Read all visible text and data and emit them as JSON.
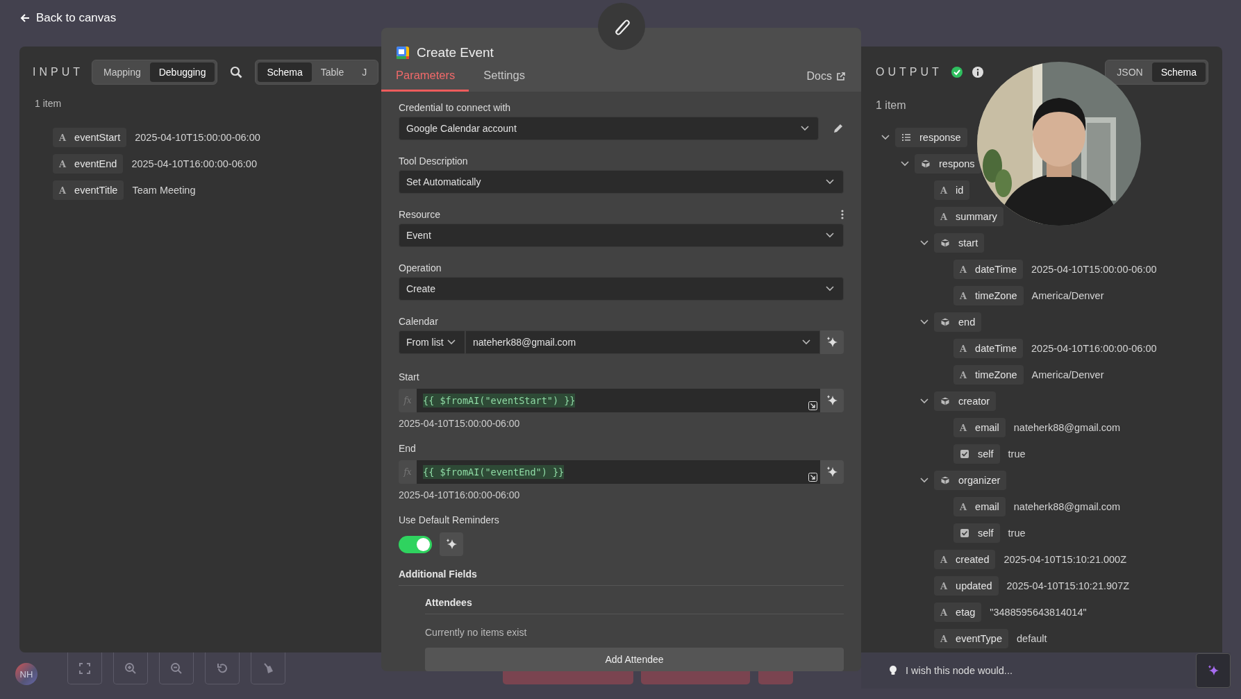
{
  "top_bar": {
    "back_link": "Back to canvas"
  },
  "input_panel": {
    "title": "INPUT",
    "mode_tabs": [
      {
        "label": "Mapping",
        "selected": false
      },
      {
        "label": "Debugging",
        "selected": true
      }
    ],
    "view_tabs": [
      {
        "label": "Schema",
        "selected": true
      },
      {
        "label": "Table",
        "selected": false
      },
      {
        "label": "J",
        "selected": false
      }
    ],
    "item_count": "1 item",
    "fields": [
      {
        "kind": "string",
        "type_glyph": "A",
        "key": "eventStart",
        "value": "2025-04-10T15:00:00-06:00"
      },
      {
        "kind": "string",
        "type_glyph": "A",
        "key": "eventEnd",
        "value": "2025-04-10T16:00:00-06:00"
      },
      {
        "kind": "string",
        "type_glyph": "A",
        "key": "eventTitle",
        "value": "Team Meeting"
      }
    ]
  },
  "node_dialog": {
    "title": "Create Event",
    "tabs": [
      {
        "label": "Parameters",
        "selected": true
      },
      {
        "label": "Settings",
        "selected": false
      }
    ],
    "docs_link": "Docs",
    "parameters": [
      {
        "kind": "select",
        "label": "Credential to connect with",
        "value": "Google Calendar account",
        "editable": true
      },
      {
        "kind": "select",
        "label": "Tool Description",
        "value": "Set Automatically"
      },
      {
        "kind": "select",
        "label": "Resource",
        "value": "Event",
        "has_menu": true
      },
      {
        "kind": "select",
        "label": "Operation",
        "value": "Create"
      },
      {
        "kind": "calendar",
        "label": "Calendar",
        "mode": "From list",
        "value": "nateherk88@gmail.com"
      },
      {
        "kind": "expression",
        "label": "Start",
        "prefix": "fx",
        "expression": "{{ $fromAI(\"eventStart\") }}",
        "preview": "2025-04-10T15:00:00-06:00"
      },
      {
        "kind": "expression",
        "label": "End",
        "prefix": "fx",
        "expression": "{{ $fromAI(\"eventEnd\") }}",
        "preview": "2025-04-10T16:00:00-06:00"
      },
      {
        "kind": "toggle",
        "label": "Use Default Reminders",
        "on": true
      },
      {
        "kind": "collection",
        "label": "Additional Fields",
        "sections": [
          {
            "title": "Attendees",
            "empty_text": "Currently no items exist",
            "add_button": "Add Attendee"
          }
        ]
      }
    ]
  },
  "output_panel": {
    "title": "OUTPUT",
    "success": true,
    "view_tabs": [
      {
        "label": "JSON",
        "selected": false
      },
      {
        "label": "Schema",
        "selected": true
      }
    ],
    "item_count": "1 item",
    "tree": [
      {
        "kind": "array",
        "key": "response",
        "expanded": true,
        "children": [
          {
            "kind": "object",
            "key": "respons",
            "expanded": true,
            "children": [
              {
                "kind": "string",
                "type_glyph": "A",
                "key": "id"
              },
              {
                "kind": "string",
                "type_glyph": "A",
                "key": "summary"
              },
              {
                "kind": "object",
                "key": "start",
                "expanded": true,
                "children": [
                  {
                    "kind": "string",
                    "type_glyph": "A",
                    "key": "dateTime",
                    "value": "2025-04-10T15:00:00-06:00"
                  },
                  {
                    "kind": "string",
                    "type_glyph": "A",
                    "key": "timeZone",
                    "value": "America/Denver"
                  }
                ]
              },
              {
                "kind": "object",
                "key": "end",
                "expanded": true,
                "children": [
                  {
                    "kind": "string",
                    "type_glyph": "A",
                    "key": "dateTime",
                    "value": "2025-04-10T16:00:00-06:00"
                  },
                  {
                    "kind": "string",
                    "type_glyph": "A",
                    "key": "timeZone",
                    "value": "America/Denver"
                  }
                ]
              },
              {
                "kind": "object",
                "key": "creator",
                "expanded": true,
                "children": [
                  {
                    "kind": "string",
                    "type_glyph": "A",
                    "key": "email",
                    "value": "nateherk88@gmail.com"
                  },
                  {
                    "kind": "boolean",
                    "key": "self",
                    "value": "true"
                  }
                ]
              },
              {
                "kind": "object",
                "key": "organizer",
                "expanded": true,
                "children": [
                  {
                    "kind": "string",
                    "type_glyph": "A",
                    "key": "email",
                    "value": "nateherk88@gmail.com"
                  },
                  {
                    "kind": "boolean",
                    "key": "self",
                    "value": "true"
                  }
                ]
              },
              {
                "kind": "string",
                "type_glyph": "A",
                "key": "created",
                "value": "2025-04-10T15:10:21.000Z"
              },
              {
                "kind": "string",
                "type_glyph": "A",
                "key": "updated",
                "value": "2025-04-10T15:10:21.907Z"
              },
              {
                "kind": "string",
                "type_glyph": "A",
                "key": "etag",
                "value": "\"3488595643814014\""
              },
              {
                "kind": "string",
                "type_glyph": "A",
                "key": "eventType",
                "value": "default"
              }
            ]
          }
        ]
      }
    ]
  },
  "feedback_bar": {
    "placeholder": "I wish this node would..."
  },
  "canvas_toolbar": {
    "avatar": "NH",
    "buttons": [
      {
        "kind": "fit"
      },
      {
        "kind": "zoom_in"
      },
      {
        "kind": "zoom_out"
      },
      {
        "kind": "reset"
      },
      {
        "kind": "tidy"
      }
    ]
  }
}
